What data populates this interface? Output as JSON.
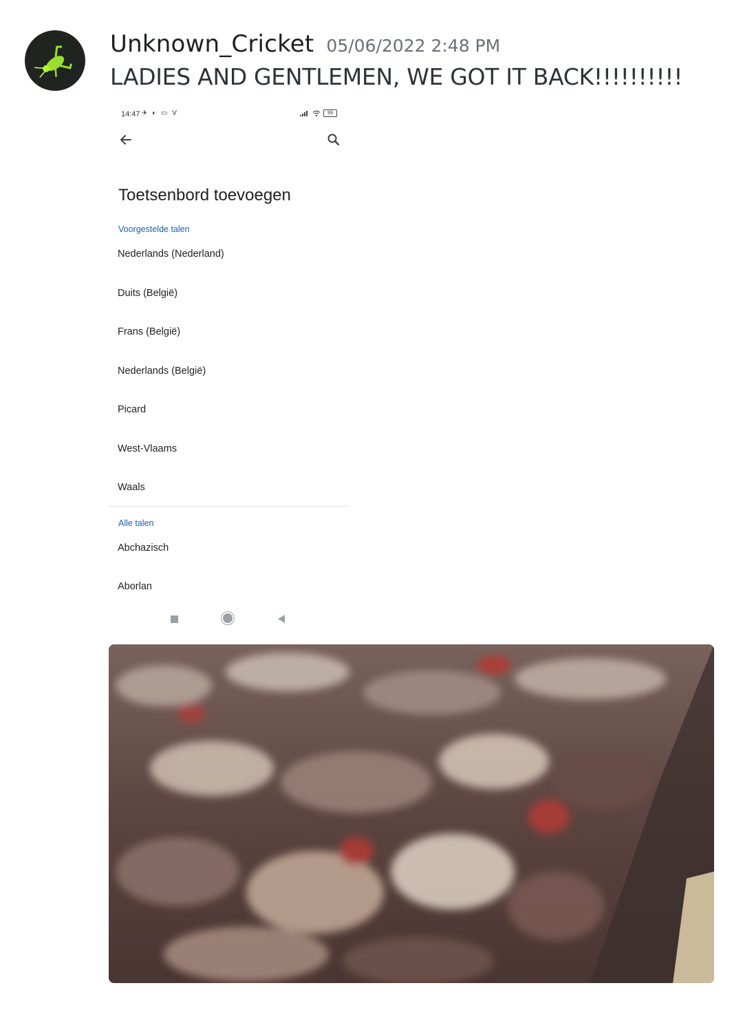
{
  "message": {
    "username": "Unknown_Cricket",
    "timestamp": "05/06/2022 2:48 PM",
    "text": "LADIES AND GENTLEMEN, WE GOT IT BACK!!!!!!!!!!"
  },
  "avatar": {
    "icon": "cricket-icon",
    "background": "#1f2421",
    "accent": "#9ade2b"
  },
  "phone_screenshot": {
    "status_bar": {
      "time": "14:47",
      "left_icons": "✈ ◐ ▭ V",
      "battery": "99"
    },
    "title": "Toetsenbord toevoegen",
    "sections": [
      {
        "label": "Voorgestelde talen",
        "items": [
          "Nederlands (Nederland)",
          "Duits (België)",
          "Frans (België)",
          "Nederlands (België)",
          "Picard",
          "West-Vlaams",
          "Waals"
        ]
      },
      {
        "label": "Alle talen",
        "items": [
          "Abchazisch",
          "Aborlan"
        ]
      }
    ]
  },
  "crowd_image": {
    "description_colors": [
      "#5a3f3a",
      "#c9b8a8",
      "#b33a34"
    ]
  }
}
